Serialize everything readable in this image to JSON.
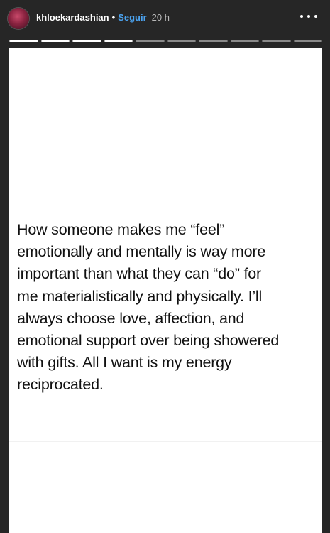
{
  "header": {
    "username": "khloekardashian",
    "separator": "•",
    "follow_label": "Seguir",
    "time_ago": "20 h"
  },
  "progress": {
    "segments_total": 10,
    "segments_viewed": 4
  },
  "story": {
    "text": "How someone makes me “feel”\nemotionally and mentally is way more\nimportant than what they can “do” for\nme materialistically and physically. I’ll\nalways choose love, affection, and\nemotional support over being showered\nwith gifts. All I want is my energy\nreciprocated."
  }
}
